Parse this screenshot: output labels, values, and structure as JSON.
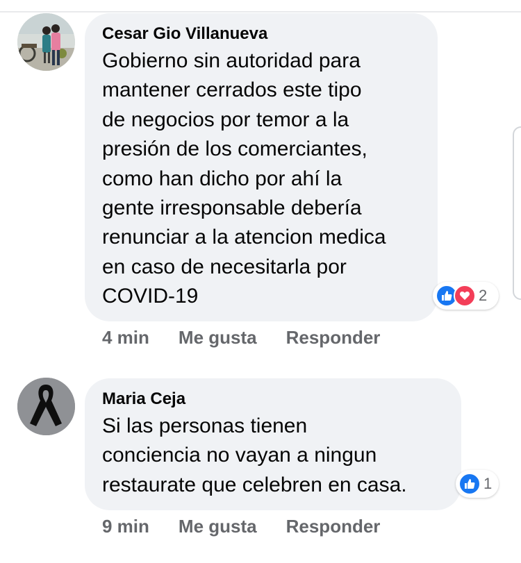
{
  "comments": [
    {
      "author": "Cesar Gio Villanueva",
      "text": "Gobierno sin autoridad para\nmantener cerrados este tipo\nde negocios por temor a la\npresión de los comerciantes,\ncomo han dicho por ahí la\ngente irresponsable debería\nrenunciar a la atencion medica\nen caso de necesitarla por\nCOVID-19",
      "reactions": {
        "icons": [
          "like-icon",
          "love-icon"
        ],
        "count": "2"
      },
      "time": "4 min",
      "like_label": "Me gusta",
      "reply_label": "Responder",
      "avatar": "couple-photo"
    },
    {
      "author": "Maria Ceja",
      "text": "Si las personas tienen\nconciencia no vayan a ningun\nrestaurate que celebren en casa.",
      "reactions": {
        "icons": [
          "like-icon"
        ],
        "count": "1"
      },
      "time": "9 min",
      "like_label": "Me gusta",
      "reply_label": "Responder",
      "avatar": "black-ribbon"
    }
  ],
  "colors": {
    "bubble": "#f0f2f5",
    "secondary_text": "#65676b",
    "like_blue": "#1877f2",
    "love_red": "#f33e58"
  }
}
